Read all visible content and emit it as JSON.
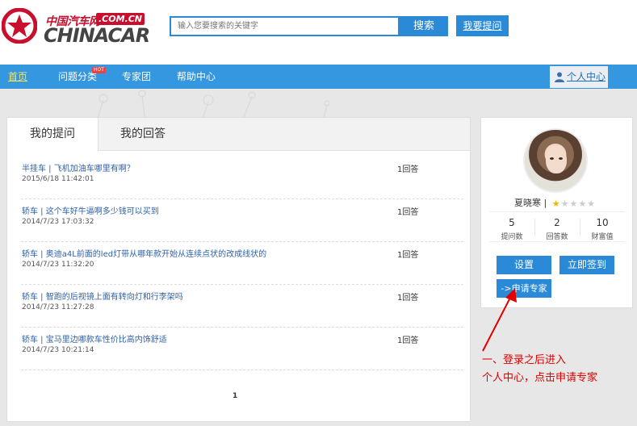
{
  "brand": {
    "cn": "中国汽车网",
    "com": ".COM.CN",
    "en": "CHINACAR"
  },
  "search": {
    "placeholder": "输入您要搜索的关键字",
    "button": "搜索",
    "ask_button": "我要提问"
  },
  "nav": {
    "items": [
      "首页",
      "问题分类",
      "专家团",
      "帮助中心"
    ],
    "hot_tag": "HOT",
    "user_center": "个人中心"
  },
  "tabs": [
    "我的提问",
    "我的回答"
  ],
  "questions": [
    {
      "title": "半挂车 | 飞机加油车哪里有啊？",
      "date": "2015/6/18 11:42:01",
      "answers": "1回答"
    },
    {
      "title": "轿车 | 这个车好牛逼啊多少钱可以买到",
      "date": "2014/7/23 17:03:32",
      "answers": "1回答"
    },
    {
      "title": "轿车 | 奥迪a4L前面的led灯带从哪年款开始从连续点状的改成线状的",
      "date": "2014/7/23 11:32:20",
      "answers": "1回答"
    },
    {
      "title": "轿车 | 智跑的后视镜上面有转向灯和行李架吗",
      "date": "2014/7/23 11:27:28",
      "answers": "1回答"
    },
    {
      "title": "轿车 | 宝马里边哪款车性价比高内饰舒适",
      "date": "2014/7/23 10:21:14",
      "answers": "1回答"
    }
  ],
  "pager": "1",
  "profile": {
    "name": "夏晓寒",
    "separator": "|",
    "stars_on": 1,
    "stars_total": 5,
    "stats": [
      {
        "value": "5",
        "label": "提问数"
      },
      {
        "value": "2",
        "label": "回答数"
      },
      {
        "value": "10",
        "label": "财富值"
      }
    ],
    "settings_button": "设置",
    "sign_button": "立即签到",
    "apply_button": "->申请专家"
  },
  "annotation": {
    "line1": "一、登录之后进入",
    "line2": "个人中心，点击申请专家",
    "color": "#e00000"
  },
  "colors": {
    "primary": "#2a8ad8",
    "nav": "#3597e0",
    "brand_red": "#c8102e",
    "link": "#2e62a8"
  }
}
